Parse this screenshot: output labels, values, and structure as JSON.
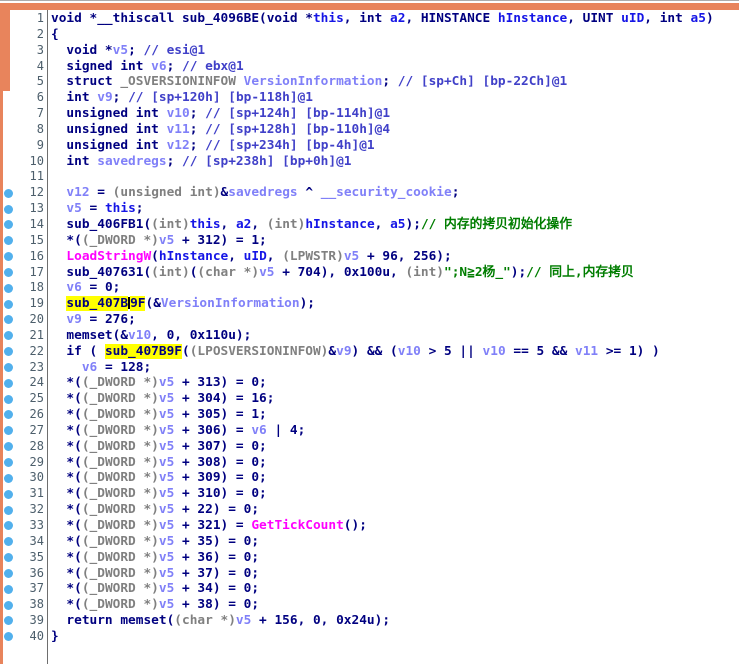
{
  "palette": {
    "accent": "#E8845C",
    "frameline": "#ACACAC",
    "dot": "#52B0EC",
    "linenum": "#4C5E6B",
    "navy": "#000080",
    "gray": "#808080",
    "local": "#8080F8",
    "arg": "#1515E6",
    "import": "#FF00FF",
    "comment": "#4040C8",
    "green": "#007D00",
    "hl": "#FFFF00"
  },
  "lines": [
    {
      "n": 1,
      "dot": false,
      "seg": [
        [
          "d",
          "void *__thiscall sub_4096BE(void *"
        ],
        [
          "a",
          "this"
        ],
        [
          "d",
          ", int "
        ],
        [
          "a",
          "a2"
        ],
        [
          "d",
          ", HINSTANCE "
        ],
        [
          "a",
          "hInstance"
        ],
        [
          "d",
          ", UINT "
        ],
        [
          "a",
          "uID"
        ],
        [
          "d",
          ", int "
        ],
        [
          "a",
          "a5"
        ],
        [
          "d",
          ")"
        ]
      ]
    },
    {
      "n": 2,
      "dot": false,
      "seg": [
        [
          "d",
          "{"
        ]
      ]
    },
    {
      "n": 3,
      "dot": false,
      "seg": [
        [
          "d",
          "  void *"
        ],
        [
          "l",
          "v5"
        ],
        [
          "d",
          "; "
        ],
        [
          "c",
          "// esi@1"
        ]
      ]
    },
    {
      "n": 4,
      "dot": false,
      "seg": [
        [
          "d",
          "  signed int "
        ],
        [
          "l",
          "v6"
        ],
        [
          "d",
          "; "
        ],
        [
          "c",
          "// ebx@1"
        ]
      ]
    },
    {
      "n": 5,
      "dot": false,
      "seg": [
        [
          "d",
          "  struct "
        ],
        [
          "g",
          "_OSVERSIONINFOW"
        ],
        [
          "d",
          " "
        ],
        [
          "l",
          "VersionInformation"
        ],
        [
          "d",
          "; "
        ],
        [
          "c",
          "// [sp+Ch] [bp-22Ch]@1"
        ]
      ]
    },
    {
      "n": 6,
      "dot": false,
      "seg": [
        [
          "d",
          "  int "
        ],
        [
          "l",
          "v9"
        ],
        [
          "d",
          "; "
        ],
        [
          "c",
          "// [sp+120h] [bp-118h]@1"
        ]
      ]
    },
    {
      "n": 7,
      "dot": false,
      "seg": [
        [
          "d",
          "  unsigned int "
        ],
        [
          "l",
          "v10"
        ],
        [
          "d",
          "; "
        ],
        [
          "c",
          "// [sp+124h] [bp-114h]@1"
        ]
      ]
    },
    {
      "n": 8,
      "dot": false,
      "seg": [
        [
          "d",
          "  unsigned int "
        ],
        [
          "l",
          "v11"
        ],
        [
          "d",
          "; "
        ],
        [
          "c",
          "// [sp+128h] [bp-110h]@4"
        ]
      ]
    },
    {
      "n": 9,
      "dot": false,
      "seg": [
        [
          "d",
          "  unsigned int "
        ],
        [
          "l",
          "v12"
        ],
        [
          "d",
          "; "
        ],
        [
          "c",
          "// [sp+234h] [bp-4h]@1"
        ]
      ]
    },
    {
      "n": 10,
      "dot": false,
      "seg": [
        [
          "d",
          "  int "
        ],
        [
          "l",
          "savedregs"
        ],
        [
          "d",
          "; "
        ],
        [
          "c",
          "// [sp+238h] [bp+0h]@1"
        ]
      ]
    },
    {
      "n": 11,
      "dot": false,
      "seg": []
    },
    {
      "n": 12,
      "dot": true,
      "seg": [
        [
          "d",
          "  "
        ],
        [
          "l",
          "v12"
        ],
        [
          "d",
          " = "
        ],
        [
          "g",
          "(unsigned int)"
        ],
        [
          "d",
          "&"
        ],
        [
          "l",
          "savedregs"
        ],
        [
          "d",
          " ^ "
        ],
        [
          "l",
          "__security_cookie"
        ],
        [
          "d",
          ";"
        ]
      ]
    },
    {
      "n": 13,
      "dot": true,
      "seg": [
        [
          "d",
          "  "
        ],
        [
          "l",
          "v5"
        ],
        [
          "d",
          " = "
        ],
        [
          "a",
          "this"
        ],
        [
          "d",
          ";"
        ]
      ]
    },
    {
      "n": 14,
      "dot": true,
      "seg": [
        [
          "d",
          "  sub_406FB1("
        ],
        [
          "g",
          "(int)"
        ],
        [
          "a",
          "this"
        ],
        [
          "d",
          ", "
        ],
        [
          "a",
          "a2"
        ],
        [
          "d",
          ", "
        ],
        [
          "g",
          "(int)"
        ],
        [
          "a",
          "hInstance"
        ],
        [
          "d",
          ", "
        ],
        [
          "a",
          "a5"
        ],
        [
          "d",
          ");"
        ],
        [
          "n",
          "// 内存的拷贝初始化操作"
        ]
      ]
    },
    {
      "n": 15,
      "dot": true,
      "seg": [
        [
          "d",
          "  *("
        ],
        [
          "g",
          "(_DWORD *)"
        ],
        [
          "l",
          "v5"
        ],
        [
          "d",
          " + 312) = 1;"
        ]
      ]
    },
    {
      "n": 16,
      "dot": true,
      "seg": [
        [
          "d",
          "  "
        ],
        [
          "m",
          "LoadStringW"
        ],
        [
          "d",
          "("
        ],
        [
          "a",
          "hInstance"
        ],
        [
          "d",
          ", "
        ],
        [
          "a",
          "uID"
        ],
        [
          "d",
          ", "
        ],
        [
          "g",
          "(LPWSTR)"
        ],
        [
          "l",
          "v5"
        ],
        [
          "d",
          " + 96, 256);"
        ]
      ]
    },
    {
      "n": 17,
      "dot": true,
      "seg": [
        [
          "d",
          "  sub_407631("
        ],
        [
          "g",
          "(int)"
        ],
        [
          "d",
          "("
        ],
        [
          "g",
          "(char *)"
        ],
        [
          "l",
          "v5"
        ],
        [
          "d",
          " + 704), 0x100u, "
        ],
        [
          "g",
          "(int)"
        ],
        [
          "s",
          "\";N≧2杨_\""
        ],
        [
          "d",
          ");"
        ],
        [
          "n",
          "// 同上,内存拷贝"
        ]
      ]
    },
    {
      "n": 18,
      "dot": true,
      "seg": [
        [
          "d",
          "  "
        ],
        [
          "l",
          "v6"
        ],
        [
          "d",
          " = 0;"
        ]
      ]
    },
    {
      "n": 19,
      "dot": true,
      "seg": [
        [
          "d",
          "  "
        ],
        [
          "h",
          "sub_407B"
        ],
        [
          "caret",
          ""
        ],
        [
          "h",
          "9F"
        ],
        [
          "d",
          "(&"
        ],
        [
          "l",
          "VersionInformation"
        ],
        [
          "d",
          ");"
        ]
      ]
    },
    {
      "n": 20,
      "dot": true,
      "seg": [
        [
          "d",
          "  "
        ],
        [
          "l",
          "v9"
        ],
        [
          "d",
          " = 276;"
        ]
      ]
    },
    {
      "n": 21,
      "dot": true,
      "seg": [
        [
          "d",
          "  memset(&"
        ],
        [
          "l",
          "v10"
        ],
        [
          "d",
          ", 0, 0x110u);"
        ]
      ]
    },
    {
      "n": 22,
      "dot": true,
      "seg": [
        [
          "d",
          "  if ( "
        ],
        [
          "h",
          "sub_407B9F"
        ],
        [
          "d",
          "("
        ],
        [
          "g",
          "(LPOSVERSIONINFOW)"
        ],
        [
          "d",
          "&"
        ],
        [
          "l",
          "v9"
        ],
        [
          "d",
          ") && ("
        ],
        [
          "l",
          "v10"
        ],
        [
          "d",
          " > 5 || "
        ],
        [
          "l",
          "v10"
        ],
        [
          "d",
          " == 5 && "
        ],
        [
          "l",
          "v11"
        ],
        [
          "d",
          " >= 1) )"
        ]
      ]
    },
    {
      "n": 23,
      "dot": true,
      "seg": [
        [
          "d",
          "    "
        ],
        [
          "l",
          "v6"
        ],
        [
          "d",
          " = 128;"
        ]
      ]
    },
    {
      "n": 24,
      "dot": true,
      "seg": [
        [
          "d",
          "  *("
        ],
        [
          "g",
          "(_DWORD *)"
        ],
        [
          "l",
          "v5"
        ],
        [
          "d",
          " + 313) = 0;"
        ]
      ]
    },
    {
      "n": 25,
      "dot": true,
      "seg": [
        [
          "d",
          "  *("
        ],
        [
          "g",
          "(_DWORD *)"
        ],
        [
          "l",
          "v5"
        ],
        [
          "d",
          " + 304) = 16;"
        ]
      ]
    },
    {
      "n": 26,
      "dot": true,
      "seg": [
        [
          "d",
          "  *("
        ],
        [
          "g",
          "(_DWORD *)"
        ],
        [
          "l",
          "v5"
        ],
        [
          "d",
          " + 305) = 1;"
        ]
      ]
    },
    {
      "n": 27,
      "dot": true,
      "seg": [
        [
          "d",
          "  *("
        ],
        [
          "g",
          "(_DWORD *)"
        ],
        [
          "l",
          "v5"
        ],
        [
          "d",
          " + 306) = "
        ],
        [
          "l",
          "v6"
        ],
        [
          "d",
          " | 4;"
        ]
      ]
    },
    {
      "n": 28,
      "dot": true,
      "seg": [
        [
          "d",
          "  *("
        ],
        [
          "g",
          "(_DWORD *)"
        ],
        [
          "l",
          "v5"
        ],
        [
          "d",
          " + 307) = 0;"
        ]
      ]
    },
    {
      "n": 29,
      "dot": true,
      "seg": [
        [
          "d",
          "  *("
        ],
        [
          "g",
          "(_DWORD *)"
        ],
        [
          "l",
          "v5"
        ],
        [
          "d",
          " + 308) = 0;"
        ]
      ]
    },
    {
      "n": 30,
      "dot": true,
      "seg": [
        [
          "d",
          "  *("
        ],
        [
          "g",
          "(_DWORD *)"
        ],
        [
          "l",
          "v5"
        ],
        [
          "d",
          " + 309) = 0;"
        ]
      ]
    },
    {
      "n": 31,
      "dot": true,
      "seg": [
        [
          "d",
          "  *("
        ],
        [
          "g",
          "(_DWORD *)"
        ],
        [
          "l",
          "v5"
        ],
        [
          "d",
          " + 310) = 0;"
        ]
      ]
    },
    {
      "n": 32,
      "dot": true,
      "seg": [
        [
          "d",
          "  *("
        ],
        [
          "g",
          "(_DWORD *)"
        ],
        [
          "l",
          "v5"
        ],
        [
          "d",
          " + 22) = 0;"
        ]
      ]
    },
    {
      "n": 33,
      "dot": true,
      "seg": [
        [
          "d",
          "  *("
        ],
        [
          "g",
          "(_DWORD *)"
        ],
        [
          "l",
          "v5"
        ],
        [
          "d",
          " + 321) = "
        ],
        [
          "m",
          "GetTickCount"
        ],
        [
          "d",
          "();"
        ]
      ]
    },
    {
      "n": 34,
      "dot": true,
      "seg": [
        [
          "d",
          "  *("
        ],
        [
          "g",
          "(_DWORD *)"
        ],
        [
          "l",
          "v5"
        ],
        [
          "d",
          " + 35) = 0;"
        ]
      ]
    },
    {
      "n": 35,
      "dot": true,
      "seg": [
        [
          "d",
          "  *("
        ],
        [
          "g",
          "(_DWORD *)"
        ],
        [
          "l",
          "v5"
        ],
        [
          "d",
          " + 36) = 0;"
        ]
      ]
    },
    {
      "n": 36,
      "dot": true,
      "seg": [
        [
          "d",
          "  *("
        ],
        [
          "g",
          "(_DWORD *)"
        ],
        [
          "l",
          "v5"
        ],
        [
          "d",
          " + 37) = 0;"
        ]
      ]
    },
    {
      "n": 37,
      "dot": true,
      "seg": [
        [
          "d",
          "  *("
        ],
        [
          "g",
          "(_DWORD *)"
        ],
        [
          "l",
          "v5"
        ],
        [
          "d",
          " + 34) = 0;"
        ]
      ]
    },
    {
      "n": 38,
      "dot": true,
      "seg": [
        [
          "d",
          "  *("
        ],
        [
          "g",
          "(_DWORD *)"
        ],
        [
          "l",
          "v5"
        ],
        [
          "d",
          " + 38) = 0;"
        ]
      ]
    },
    {
      "n": 39,
      "dot": true,
      "seg": [
        [
          "d",
          "  return memset("
        ],
        [
          "g",
          "(char *)"
        ],
        [
          "l",
          "v5"
        ],
        [
          "d",
          " + 156, 0, 0x24u);"
        ]
      ]
    },
    {
      "n": 40,
      "dot": true,
      "seg": [
        [
          "d",
          "}"
        ]
      ]
    }
  ]
}
